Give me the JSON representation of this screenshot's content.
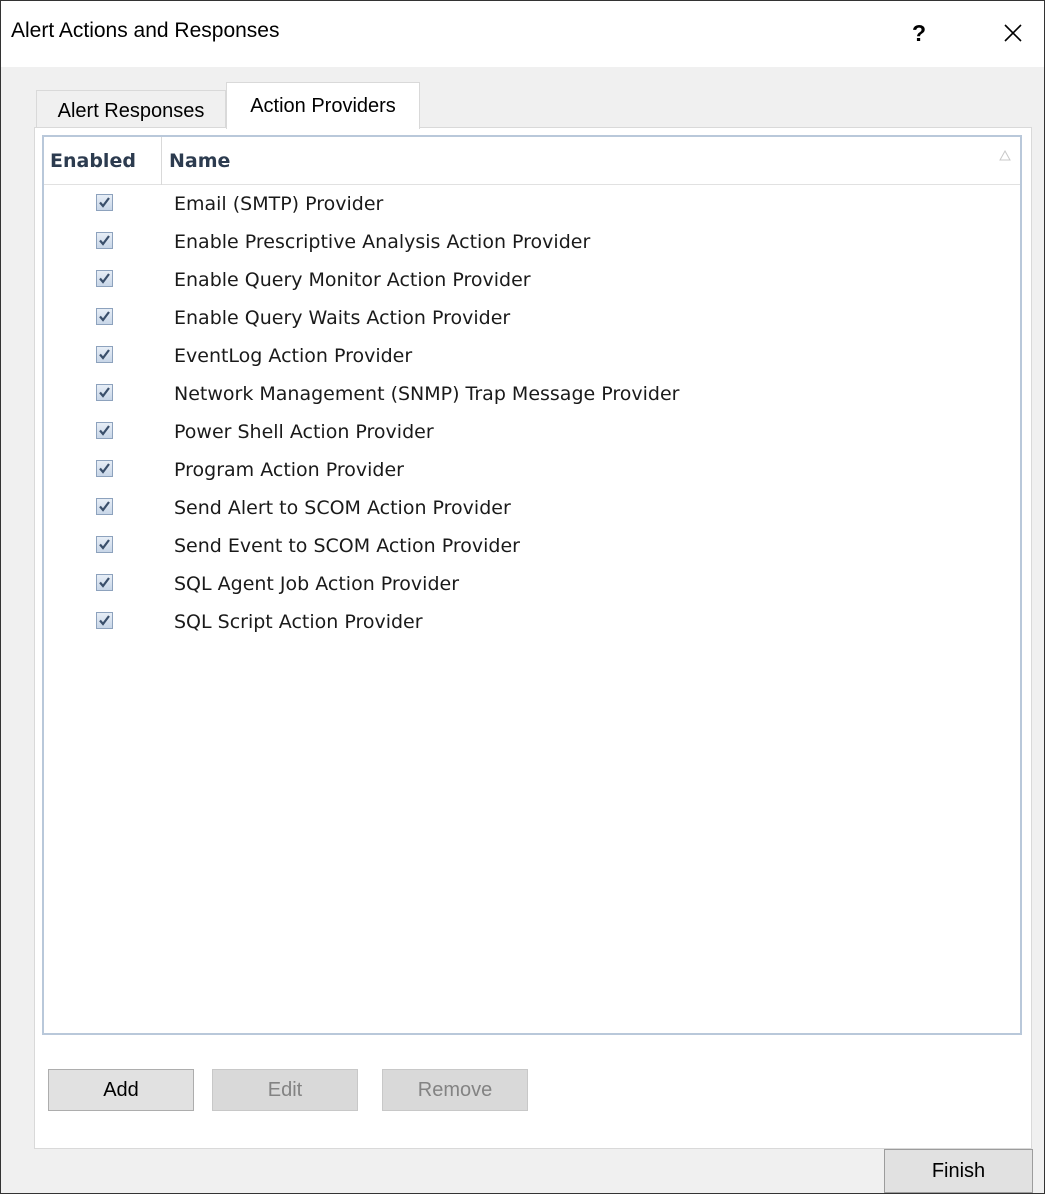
{
  "window": {
    "title": "Alert Actions and Responses",
    "help_label": "?"
  },
  "tabs": [
    {
      "label": "Alert Responses",
      "active": false
    },
    {
      "label": "Action Providers",
      "active": true
    }
  ],
  "list": {
    "columns": {
      "enabled": "Enabled",
      "name": "Name"
    },
    "rows": [
      {
        "enabled": true,
        "name": "Email (SMTP) Provider"
      },
      {
        "enabled": true,
        "name": "Enable Prescriptive Analysis Action Provider"
      },
      {
        "enabled": true,
        "name": "Enable Query Monitor Action Provider"
      },
      {
        "enabled": true,
        "name": "Enable Query Waits Action Provider"
      },
      {
        "enabled": true,
        "name": "EventLog Action Provider"
      },
      {
        "enabled": true,
        "name": "Network Management (SNMP) Trap Message Provider"
      },
      {
        "enabled": true,
        "name": "Power Shell Action Provider"
      },
      {
        "enabled": true,
        "name": "Program Action Provider"
      },
      {
        "enabled": true,
        "name": "Send Alert to SCOM Action Provider"
      },
      {
        "enabled": true,
        "name": "Send Event to SCOM Action Provider"
      },
      {
        "enabled": true,
        "name": "SQL Agent Job Action Provider"
      },
      {
        "enabled": true,
        "name": "SQL Script Action Provider"
      }
    ]
  },
  "buttons": {
    "add": "Add",
    "edit": "Edit",
    "remove": "Remove",
    "finish": "Finish"
  },
  "icons": {
    "close": "close-icon",
    "sort": "sort-ascending-icon",
    "check": "checkmark-icon"
  },
  "colors": {
    "list_border": "#b9c8da",
    "header_text": "#2c3b4f",
    "disabled_text": "#838383"
  }
}
